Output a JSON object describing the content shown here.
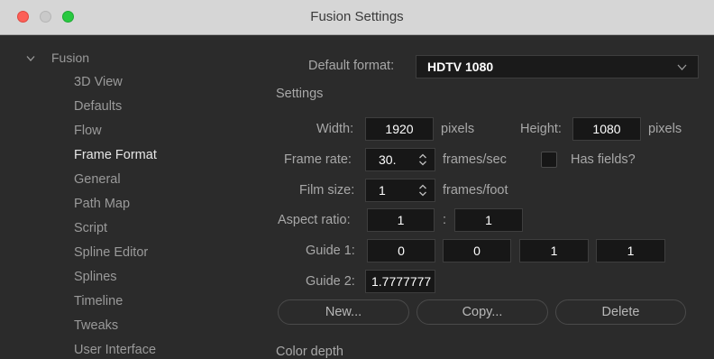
{
  "window": {
    "title": "Fusion Settings"
  },
  "sidebar": {
    "root_label": "Fusion",
    "items": [
      {
        "label": "3D View"
      },
      {
        "label": "Defaults"
      },
      {
        "label": "Flow"
      },
      {
        "label": "Frame Format",
        "active": true
      },
      {
        "label": "General"
      },
      {
        "label": "Path Map"
      },
      {
        "label": "Script"
      },
      {
        "label": "Spline Editor"
      },
      {
        "label": "Splines"
      },
      {
        "label": "Timeline"
      },
      {
        "label": "Tweaks"
      },
      {
        "label": "User Interface"
      }
    ]
  },
  "form": {
    "default_format_label": "Default format:",
    "default_format_value": "HDTV 1080",
    "settings_heading": "Settings",
    "width_label": "Width:",
    "width_value": "1920",
    "width_unit": "pixels",
    "height_label": "Height:",
    "height_value": "1080",
    "height_unit": "pixels",
    "frame_rate_label": "Frame rate:",
    "frame_rate_value": "30.",
    "frame_rate_unit": "frames/sec",
    "has_fields_label": "Has fields?",
    "has_fields_checked": false,
    "film_size_label": "Film size:",
    "film_size_value": "1",
    "film_size_unit": "frames/foot",
    "aspect_ratio_label": "Aspect ratio:",
    "aspect_x": "1",
    "aspect_sep": ":",
    "aspect_y": "1",
    "guide1_label": "Guide 1:",
    "guide1_values": [
      "0",
      "0",
      "1",
      "1"
    ],
    "guide2_label": "Guide 2:",
    "guide2_value": "1.7777777",
    "new_button": "New...",
    "copy_button": "Copy...",
    "delete_button": "Delete",
    "color_depth_heading": "Color depth"
  },
  "colors": {
    "background": "#2b2b2b",
    "field_background": "#171717",
    "titlebar": "#d6d6d6",
    "close": "#fc5f57",
    "maximize": "#29c940"
  }
}
